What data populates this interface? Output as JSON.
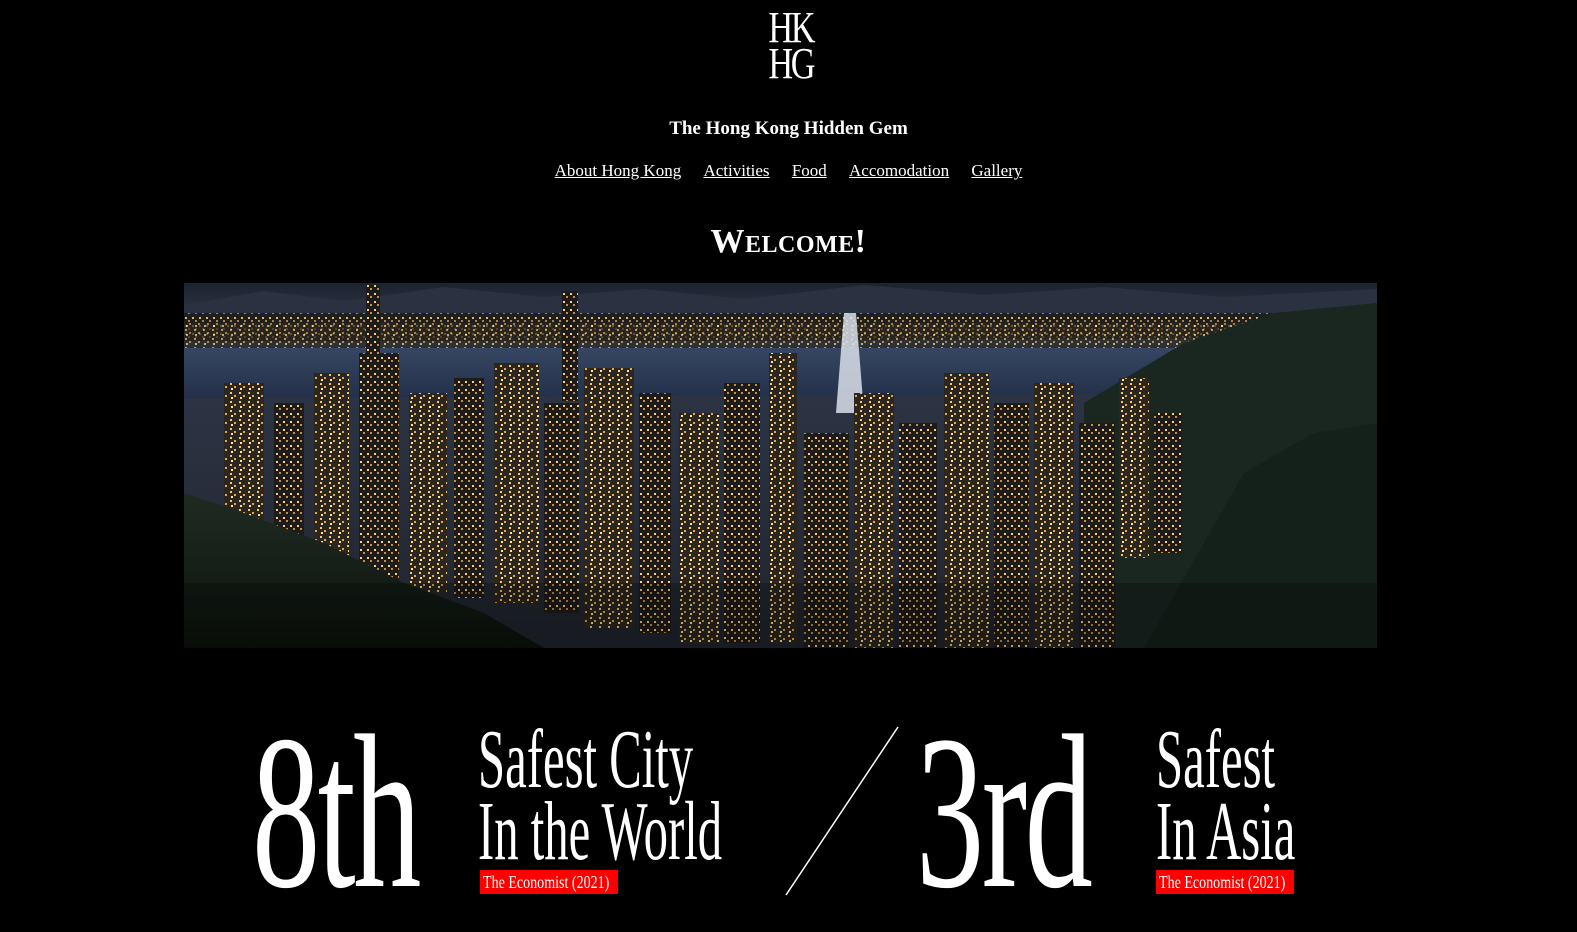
{
  "logo": {
    "line1": "HK",
    "line2": "HG"
  },
  "site": {
    "title": "The Hong Kong Hidden Gem"
  },
  "nav": {
    "items": [
      {
        "label": "About Hong Kong"
      },
      {
        "label": "Activities"
      },
      {
        "label": "Food"
      },
      {
        "label": "Accomodation"
      },
      {
        "label": "Gallery"
      }
    ]
  },
  "welcome": {
    "heading": "Welcome!"
  },
  "stats": [
    {
      "rank": "8th",
      "line1": "Safest City",
      "line2": "In the World",
      "source": "The Economist (2021)"
    },
    {
      "rank": "3rd",
      "line1": "Safest",
      "line2": "In Asia",
      "source": "The Economist (2021)"
    }
  ],
  "colors": {
    "background": "#000000",
    "text": "#ffffff",
    "source_badge": "#ff0000"
  }
}
